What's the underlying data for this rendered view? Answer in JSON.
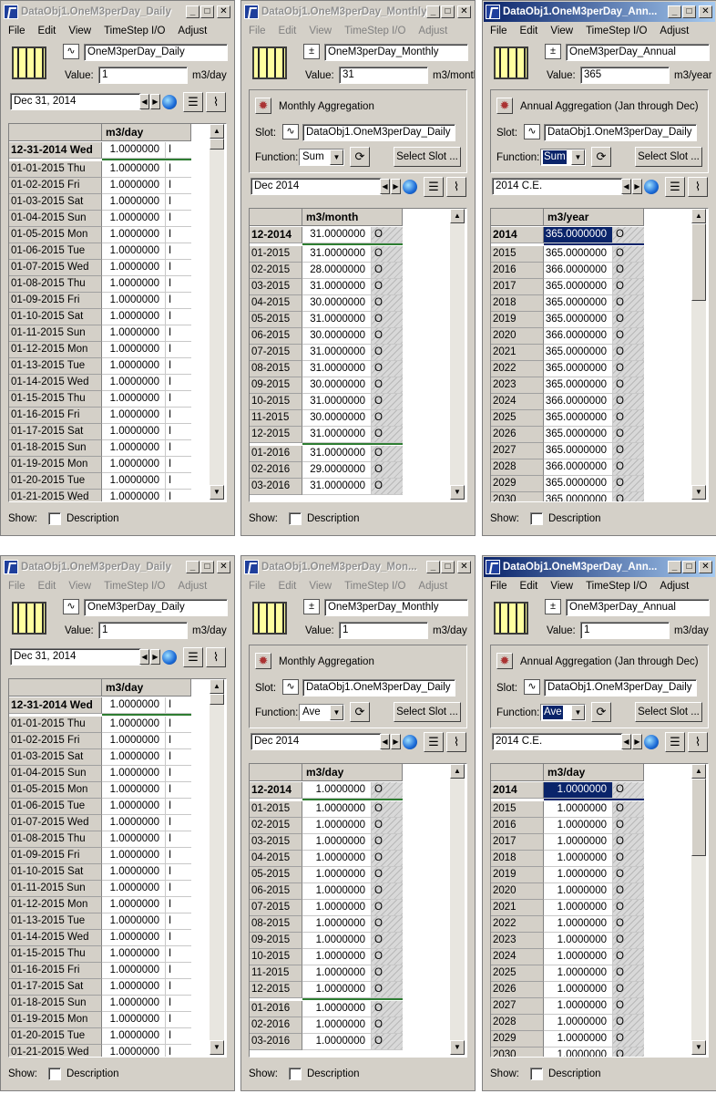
{
  "menu": [
    "File",
    "Edit",
    "View",
    "TimeStep I/O",
    "Adjust"
  ],
  "show_label": "Show:",
  "description_label": "Description",
  "slot_label": "Slot:",
  "function_label": "Function:",
  "value_label": "Value:",
  "select_slot_label": "Select Slot ...",
  "windows": [
    {
      "title": "DataObj1.OneM3perDay_Daily",
      "title_state": "inactive",
      "menu_state": "active",
      "slot_name": "OneM3perDay_Daily",
      "value": "1",
      "unit": "m3/day",
      "date": "Dec 31, 2014",
      "column_header": "m3/day",
      "rows": [
        {
          "label": "12-31-2014 Wed",
          "value": "1.0000000",
          "flag": "I"
        },
        {
          "label": "01-01-2015 Thu",
          "value": "1.0000000",
          "flag": "I"
        },
        {
          "label": "01-02-2015 Fri",
          "value": "1.0000000",
          "flag": "I"
        },
        {
          "label": "01-03-2015 Sat",
          "value": "1.0000000",
          "flag": "I"
        },
        {
          "label": "01-04-2015 Sun",
          "value": "1.0000000",
          "flag": "I"
        },
        {
          "label": "01-05-2015 Mon",
          "value": "1.0000000",
          "flag": "I"
        },
        {
          "label": "01-06-2015 Tue",
          "value": "1.0000000",
          "flag": "I"
        },
        {
          "label": "01-07-2015 Wed",
          "value": "1.0000000",
          "flag": "I"
        },
        {
          "label": "01-08-2015 Thu",
          "value": "1.0000000",
          "flag": "I"
        },
        {
          "label": "01-09-2015 Fri",
          "value": "1.0000000",
          "flag": "I"
        },
        {
          "label": "01-10-2015 Sat",
          "value": "1.0000000",
          "flag": "I"
        },
        {
          "label": "01-11-2015 Sun",
          "value": "1.0000000",
          "flag": "I"
        },
        {
          "label": "01-12-2015 Mon",
          "value": "1.0000000",
          "flag": "I"
        },
        {
          "label": "01-13-2015 Tue",
          "value": "1.0000000",
          "flag": "I"
        },
        {
          "label": "01-14-2015 Wed",
          "value": "1.0000000",
          "flag": "I"
        },
        {
          "label": "01-15-2015 Thu",
          "value": "1.0000000",
          "flag": "I"
        },
        {
          "label": "01-16-2015 Fri",
          "value": "1.0000000",
          "flag": "I"
        },
        {
          "label": "01-17-2015 Sat",
          "value": "1.0000000",
          "flag": "I"
        },
        {
          "label": "01-18-2015 Sun",
          "value": "1.0000000",
          "flag": "I"
        },
        {
          "label": "01-19-2015 Mon",
          "value": "1.0000000",
          "flag": "I"
        },
        {
          "label": "01-20-2015 Tue",
          "value": "1.0000000",
          "flag": "I"
        },
        {
          "label": "01-21-2015 Wed",
          "value": "1.0000000",
          "flag": "I"
        }
      ]
    },
    {
      "title": "DataObj1.OneM3perDay_Monthly",
      "title_state": "inactive",
      "menu_state": "inactive",
      "slot_name": "OneM3perDay_Monthly",
      "value": "31",
      "unit": "m3/month",
      "aggregation": "Monthly Aggregation",
      "agg_slot": "DataObj1.OneM3perDay_Daily",
      "function": "Sum",
      "function_selected": false,
      "date": "Dec 2014",
      "column_header": "m3/month",
      "rows": [
        {
          "label": "12-2014",
          "value": "31.0000000",
          "flag": "O"
        },
        {
          "label": "01-2015",
          "value": "31.0000000",
          "flag": "O"
        },
        {
          "label": "02-2015",
          "value": "28.0000000",
          "flag": "O"
        },
        {
          "label": "03-2015",
          "value": "31.0000000",
          "flag": "O"
        },
        {
          "label": "04-2015",
          "value": "30.0000000",
          "flag": "O"
        },
        {
          "label": "05-2015",
          "value": "31.0000000",
          "flag": "O"
        },
        {
          "label": "06-2015",
          "value": "30.0000000",
          "flag": "O"
        },
        {
          "label": "07-2015",
          "value": "31.0000000",
          "flag": "O"
        },
        {
          "label": "08-2015",
          "value": "31.0000000",
          "flag": "O"
        },
        {
          "label": "09-2015",
          "value": "30.0000000",
          "flag": "O"
        },
        {
          "label": "10-2015",
          "value": "31.0000000",
          "flag": "O"
        },
        {
          "label": "11-2015",
          "value": "30.0000000",
          "flag": "O"
        },
        {
          "label": "12-2015",
          "value": "31.0000000",
          "flag": "O"
        },
        {
          "label": "01-2016",
          "value": "31.0000000",
          "flag": "O"
        },
        {
          "label": "02-2016",
          "value": "29.0000000",
          "flag": "O"
        },
        {
          "label": "03-2016",
          "value": "31.0000000",
          "flag": "O"
        }
      ]
    },
    {
      "title": "DataObj1.OneM3perDay_Ann...",
      "title_state": "active",
      "menu_state": "active",
      "slot_name": "OneM3perDay_Annual",
      "value": "365",
      "unit": "m3/year",
      "aggregation": "Annual Aggregation (Jan through Dec)",
      "agg_slot": "DataObj1.OneM3perDay_Daily",
      "function": "Sum",
      "function_selected": true,
      "date": "2014 C.E.",
      "column_header": "m3/year",
      "rows": [
        {
          "label": "2014",
          "value": "365.0000000",
          "flag": "O"
        },
        {
          "label": "2015",
          "value": "365.0000000",
          "flag": "O"
        },
        {
          "label": "2016",
          "value": "366.0000000",
          "flag": "O"
        },
        {
          "label": "2017",
          "value": "365.0000000",
          "flag": "O"
        },
        {
          "label": "2018",
          "value": "365.0000000",
          "flag": "O"
        },
        {
          "label": "2019",
          "value": "365.0000000",
          "flag": "O"
        },
        {
          "label": "2020",
          "value": "366.0000000",
          "flag": "O"
        },
        {
          "label": "2021",
          "value": "365.0000000",
          "flag": "O"
        },
        {
          "label": "2022",
          "value": "365.0000000",
          "flag": "O"
        },
        {
          "label": "2023",
          "value": "365.0000000",
          "flag": "O"
        },
        {
          "label": "2024",
          "value": "366.0000000",
          "flag": "O"
        },
        {
          "label": "2025",
          "value": "365.0000000",
          "flag": "O"
        },
        {
          "label": "2026",
          "value": "365.0000000",
          "flag": "O"
        },
        {
          "label": "2027",
          "value": "365.0000000",
          "flag": "O"
        },
        {
          "label": "2028",
          "value": "366.0000000",
          "flag": "O"
        },
        {
          "label": "2029",
          "value": "365.0000000",
          "flag": "O"
        },
        {
          "label": "2030",
          "value": "365.0000000",
          "flag": "O"
        }
      ]
    },
    {
      "title": "DataObj1.OneM3perDay_Daily",
      "title_state": "inactive",
      "menu_state": "inactive",
      "slot_name": "OneM3perDay_Daily",
      "value": "1",
      "unit": "m3/day",
      "date": "Dec 31, 2014",
      "column_header": "m3/day",
      "rows": [
        {
          "label": "12-31-2014 Wed",
          "value": "1.0000000",
          "flag": "I"
        },
        {
          "label": "01-01-2015 Thu",
          "value": "1.0000000",
          "flag": "I"
        },
        {
          "label": "01-02-2015 Fri",
          "value": "1.0000000",
          "flag": "I"
        },
        {
          "label": "01-03-2015 Sat",
          "value": "1.0000000",
          "flag": "I"
        },
        {
          "label": "01-04-2015 Sun",
          "value": "1.0000000",
          "flag": "I"
        },
        {
          "label": "01-05-2015 Mon",
          "value": "1.0000000",
          "flag": "I"
        },
        {
          "label": "01-06-2015 Tue",
          "value": "1.0000000",
          "flag": "I"
        },
        {
          "label": "01-07-2015 Wed",
          "value": "1.0000000",
          "flag": "I"
        },
        {
          "label": "01-08-2015 Thu",
          "value": "1.0000000",
          "flag": "I"
        },
        {
          "label": "01-09-2015 Fri",
          "value": "1.0000000",
          "flag": "I"
        },
        {
          "label": "01-10-2015 Sat",
          "value": "1.0000000",
          "flag": "I"
        },
        {
          "label": "01-11-2015 Sun",
          "value": "1.0000000",
          "flag": "I"
        },
        {
          "label": "01-12-2015 Mon",
          "value": "1.0000000",
          "flag": "I"
        },
        {
          "label": "01-13-2015 Tue",
          "value": "1.0000000",
          "flag": "I"
        },
        {
          "label": "01-14-2015 Wed",
          "value": "1.0000000",
          "flag": "I"
        },
        {
          "label": "01-15-2015 Thu",
          "value": "1.0000000",
          "flag": "I"
        },
        {
          "label": "01-16-2015 Fri",
          "value": "1.0000000",
          "flag": "I"
        },
        {
          "label": "01-17-2015 Sat",
          "value": "1.0000000",
          "flag": "I"
        },
        {
          "label": "01-18-2015 Sun",
          "value": "1.0000000",
          "flag": "I"
        },
        {
          "label": "01-19-2015 Mon",
          "value": "1.0000000",
          "flag": "I"
        },
        {
          "label": "01-20-2015 Tue",
          "value": "1.0000000",
          "flag": "I"
        },
        {
          "label": "01-21-2015 Wed",
          "value": "1.0000000",
          "flag": "I"
        }
      ]
    },
    {
      "title": "DataObj1.OneM3perDay_Mon...",
      "title_state": "inactive",
      "menu_state": "inactive",
      "slot_name": "OneM3perDay_Monthly",
      "value": "1",
      "unit": "m3/day",
      "aggregation": "Monthly Aggregation",
      "agg_slot": "DataObj1.OneM3perDay_Daily",
      "function": "Ave",
      "function_selected": false,
      "date": "Dec 2014",
      "column_header": "m3/day",
      "rows": [
        {
          "label": "12-2014",
          "value": "1.0000000",
          "flag": "O"
        },
        {
          "label": "01-2015",
          "value": "1.0000000",
          "flag": "O"
        },
        {
          "label": "02-2015",
          "value": "1.0000000",
          "flag": "O"
        },
        {
          "label": "03-2015",
          "value": "1.0000000",
          "flag": "O"
        },
        {
          "label": "04-2015",
          "value": "1.0000000",
          "flag": "O"
        },
        {
          "label": "05-2015",
          "value": "1.0000000",
          "flag": "O"
        },
        {
          "label": "06-2015",
          "value": "1.0000000",
          "flag": "O"
        },
        {
          "label": "07-2015",
          "value": "1.0000000",
          "flag": "O"
        },
        {
          "label": "08-2015",
          "value": "1.0000000",
          "flag": "O"
        },
        {
          "label": "09-2015",
          "value": "1.0000000",
          "flag": "O"
        },
        {
          "label": "10-2015",
          "value": "1.0000000",
          "flag": "O"
        },
        {
          "label": "11-2015",
          "value": "1.0000000",
          "flag": "O"
        },
        {
          "label": "12-2015",
          "value": "1.0000000",
          "flag": "O"
        },
        {
          "label": "01-2016",
          "value": "1.0000000",
          "flag": "O"
        },
        {
          "label": "02-2016",
          "value": "1.0000000",
          "flag": "O"
        },
        {
          "label": "03-2016",
          "value": "1.0000000",
          "flag": "O"
        }
      ]
    },
    {
      "title": "DataObj1.OneM3perDay_Ann...",
      "title_state": "active",
      "menu_state": "active",
      "slot_name": "OneM3perDay_Annual",
      "value": "1",
      "unit": "m3/day",
      "aggregation": "Annual Aggregation (Jan through Dec)",
      "agg_slot": "DataObj1.OneM3perDay_Daily",
      "function": "Ave",
      "function_selected": true,
      "date": "2014 C.E.",
      "column_header": "m3/day",
      "rows": [
        {
          "label": "2014",
          "value": "1.0000000",
          "flag": "O"
        },
        {
          "label": "2015",
          "value": "1.0000000",
          "flag": "O"
        },
        {
          "label": "2016",
          "value": "1.0000000",
          "flag": "O"
        },
        {
          "label": "2017",
          "value": "1.0000000",
          "flag": "O"
        },
        {
          "label": "2018",
          "value": "1.0000000",
          "flag": "O"
        },
        {
          "label": "2019",
          "value": "1.0000000",
          "flag": "O"
        },
        {
          "label": "2020",
          "value": "1.0000000",
          "flag": "O"
        },
        {
          "label": "2021",
          "value": "1.0000000",
          "flag": "O"
        },
        {
          "label": "2022",
          "value": "1.0000000",
          "flag": "O"
        },
        {
          "label": "2023",
          "value": "1.0000000",
          "flag": "O"
        },
        {
          "label": "2024",
          "value": "1.0000000",
          "flag": "O"
        },
        {
          "label": "2025",
          "value": "1.0000000",
          "flag": "O"
        },
        {
          "label": "2026",
          "value": "1.0000000",
          "flag": "O"
        },
        {
          "label": "2027",
          "value": "1.0000000",
          "flag": "O"
        },
        {
          "label": "2028",
          "value": "1.0000000",
          "flag": "O"
        },
        {
          "label": "2029",
          "value": "1.0000000",
          "flag": "O"
        },
        {
          "label": "2030",
          "value": "1.0000000",
          "flag": "O"
        }
      ]
    }
  ]
}
